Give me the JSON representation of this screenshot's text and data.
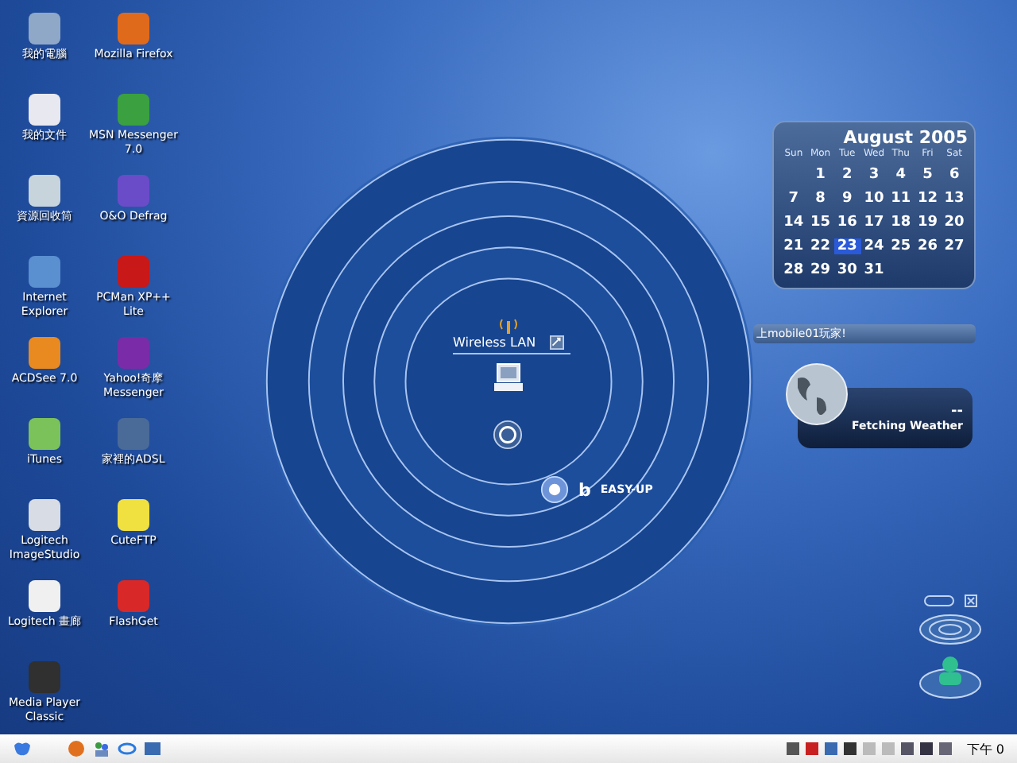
{
  "desktop_icons": [
    [
      {
        "label": "我的電腦",
        "color": "#8fa8c8"
      },
      {
        "label": "我的文件",
        "color": "#e8e8f0"
      },
      {
        "label": "資源回收筒",
        "color": "#c8d4dc"
      },
      {
        "label": "Internet Explorer",
        "color": "#5a8fd0"
      },
      {
        "label": "ACDSee 7.0",
        "color": "#e88a20"
      },
      {
        "label": "iTunes",
        "color": "#7cc25a"
      },
      {
        "label": "Logitech ImageStudio",
        "color": "#d8dce4"
      },
      {
        "label": "Logitech 畫廊",
        "color": "#f0f0f0"
      },
      {
        "label": "Media Player Classic",
        "color": "#303030"
      }
    ],
    [
      {
        "label": "Mozilla Firefox",
        "color": "#e06a1c"
      },
      {
        "label": "MSN Messenger 7.0",
        "color": "#3aa040"
      },
      {
        "label": "O&O Defrag",
        "color": "#6a4cc8"
      },
      {
        "label": "PCMan XP++ Lite",
        "color": "#c81818"
      },
      {
        "label": "Yahoo!奇摩 Messenger",
        "color": "#7a2ca8"
      },
      {
        "label": "家裡的ADSL",
        "color": "#4a6a98"
      },
      {
        "label": "CuteFTP",
        "color": "#f0e040"
      },
      {
        "label": "FlashGet",
        "color": "#d82828"
      }
    ]
  ],
  "network_widget": {
    "title": "Wireless LAN",
    "easy_up": "EASY-UP",
    "easy_up_mark": "b"
  },
  "calendar": {
    "title": "August 2005",
    "weekdays": [
      "Sun",
      "Mon",
      "Tue",
      "Wed",
      "Thu",
      "Fri",
      "Sat"
    ],
    "weeks": [
      {
        "kind": "leading",
        "days": [
          {
            "label": "1",
            "selected": false
          },
          {
            "label": "2",
            "selected": false
          },
          {
            "label": "3",
            "selected": false
          },
          {
            "label": "4",
            "selected": false
          },
          {
            "label": "5",
            "selected": false
          },
          {
            "label": "6",
            "selected": false
          }
        ]
      },
      {
        "kind": "full",
        "days": [
          {
            "label": "7",
            "selected": false
          },
          {
            "label": "8",
            "selected": false
          },
          {
            "label": "9",
            "selected": false
          },
          {
            "label": "10",
            "selected": false
          },
          {
            "label": "11",
            "selected": false
          },
          {
            "label": "12",
            "selected": false
          },
          {
            "label": "13",
            "selected": false
          }
        ]
      },
      {
        "kind": "full",
        "days": [
          {
            "label": "14",
            "selected": false
          },
          {
            "label": "15",
            "selected": false
          },
          {
            "label": "16",
            "selected": false
          },
          {
            "label": "17",
            "selected": false
          },
          {
            "label": "18",
            "selected": false
          },
          {
            "label": "19",
            "selected": false
          },
          {
            "label": "20",
            "selected": false
          }
        ]
      },
      {
        "kind": "full",
        "days": [
          {
            "label": "21",
            "selected": false
          },
          {
            "label": "22",
            "selected": false
          },
          {
            "label": "23",
            "selected": true
          },
          {
            "label": "24",
            "selected": false
          },
          {
            "label": "25",
            "selected": false
          },
          {
            "label": "26",
            "selected": false
          },
          {
            "label": "27",
            "selected": false
          }
        ]
      },
      {
        "kind": "trailing",
        "days": [
          {
            "label": "28",
            "selected": false
          },
          {
            "label": "29",
            "selected": false
          },
          {
            "label": "30",
            "selected": false
          },
          {
            "label": "31",
            "selected": false
          }
        ]
      }
    ]
  },
  "ticker": {
    "text": "上mobile01玩家!"
  },
  "weather": {
    "temperature": "--",
    "status": "Fetching Weather"
  },
  "taskbar": {
    "clock": "下午 0"
  }
}
